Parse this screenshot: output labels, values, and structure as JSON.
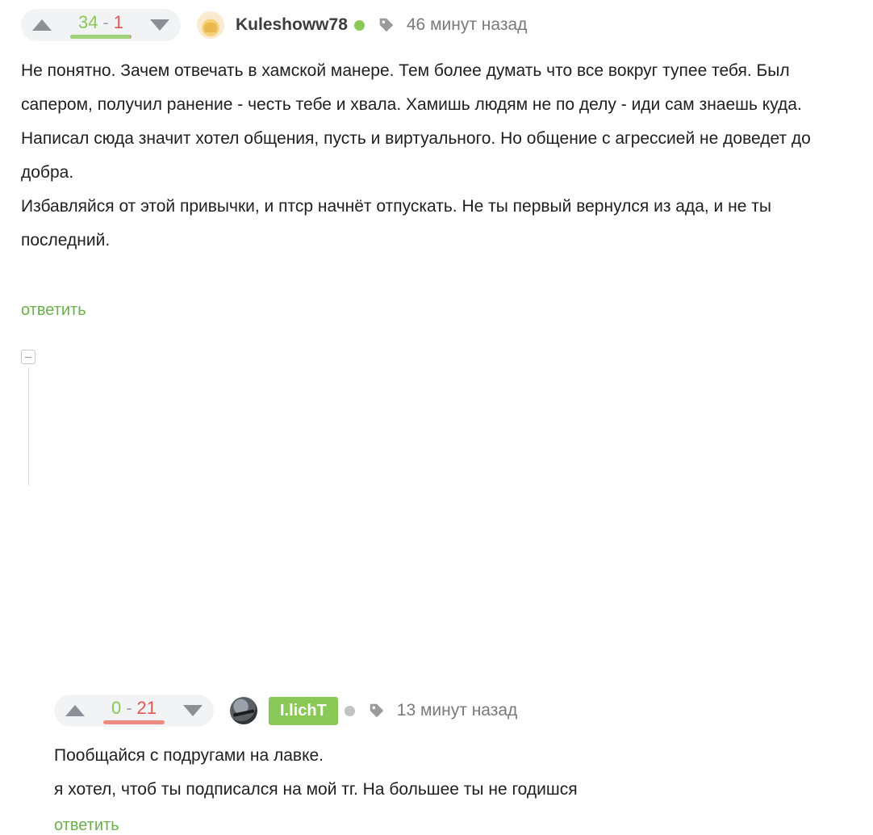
{
  "comments": [
    {
      "rating": {
        "plus": "34",
        "minus": "1",
        "separator": "-",
        "plus_share": 0.97
      },
      "author": "Kuleshoww78",
      "time": "46 минут назад",
      "online": true,
      "paragraphs": [
        "Не понятно. Зачем отвечать в хамской манере. Тем более думать что все вокруг тупее тебя. Был сапером, получил ранение - честь тебе и хвала. Хамишь людям не по делу - иди сам знаешь куда.",
        "Написал сюда значит хотел общения, пусть и виртуального. Но общение с агрессией не доведет до добра.",
        "Избавляйся от этой привычки, и птср начнёт отпускать. Не ты первый вернулся из ада, и не ты последний."
      ],
      "reply_label": "ответить"
    },
    {
      "rating": {
        "plus": "0",
        "minus": "21",
        "separator": "-",
        "plus_share": 0.0
      },
      "author": "I.lichT",
      "time": "13 минут назад",
      "online": false,
      "paragraphs": [
        "Пообщайся с подругами на лавке.",
        "я хотел, чтоб ты подписался на мой тг. На большее ты не годишся"
      ],
      "reply_label": "ответить"
    }
  ],
  "icons": {
    "upvote": "triangle-up-icon",
    "downvote": "triangle-down-icon",
    "tag": "tag-icon",
    "collapse": "minus-square-icon"
  },
  "colors": {
    "plus": "#8ac858",
    "minus": "#e0584f",
    "reply": "#6ab04c",
    "badge": "#8ac858"
  }
}
